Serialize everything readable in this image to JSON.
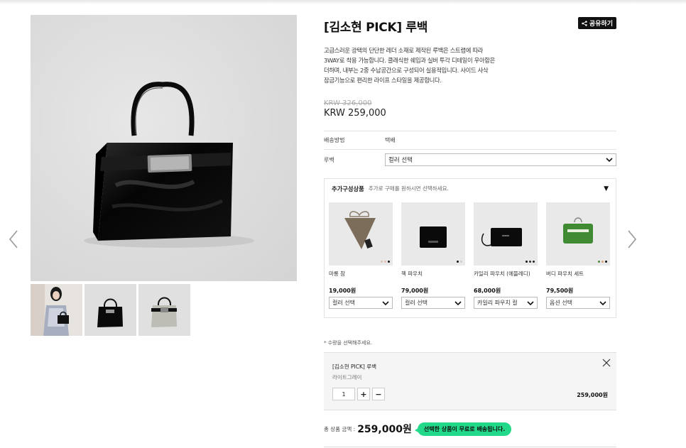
{
  "product": {
    "title": "[김소현 PICK] 루백",
    "share_label": "공유하기",
    "description": [
      "고급스러운 광택의 단단한 레더 소재로 제작된 루백은 스트랩에 따라",
      "3WAY로 착용 가능합니다. 클래식한 쉐입과 실버 투각 디테일이 우아함은",
      "더하며, 내부는 2중 수납공간으로 구성되어 실용적입니다. 사이드 사삭",
      "잠금기능으로 편리한 라이프 스타일을 제공합니다."
    ],
    "price_original": "KRW 326,000",
    "price_sale": "KRW 259,000"
  },
  "options": {
    "shipping_label": "배송방법",
    "shipping_value": "택배",
    "bag_label": "루백",
    "bag_select": "컬러 선택"
  },
  "addon": {
    "title": "추가구성상품",
    "subtitle": "추가로 구매를 원하시면 선택하세요.",
    "items": [
      {
        "name": "마롱 참",
        "price": "19,000원",
        "select": "컬러 선택",
        "dots": [
          "#d9c6b5",
          "#e9b8b8",
          "#111111"
        ]
      },
      {
        "name": "첵 파우치",
        "price": "79,000원",
        "select": "컬러 선택",
        "dots": [
          "#111111",
          "#cccccc"
        ]
      },
      {
        "name": "카일리 파우치 (에뜰레디)",
        "price": "68,000원",
        "select": "카일리 파우치 컬",
        "dots": [
          "#111111",
          "#333333",
          "#222222"
        ]
      },
      {
        "name": "버디 파우치 세트",
        "price": "79,500원",
        "select": "옵션 선택",
        "dots": [
          "#4a8a3a",
          "#d9a37a",
          "#111111"
        ]
      }
    ]
  },
  "cart": {
    "note": "* 수량을 선택해주세요.",
    "item_title": "[김소현 PICK] 루백",
    "item_color": "라이트그레이",
    "quantity": "1",
    "item_price": "259,000원"
  },
  "total": {
    "label": "총 상품 금액 :",
    "amount": "259,000원",
    "badge": "선택한 상품이 무료로 배송됩니다."
  },
  "colors": {
    "accent_badge": "#22d98a",
    "share_bg": "#111111"
  }
}
